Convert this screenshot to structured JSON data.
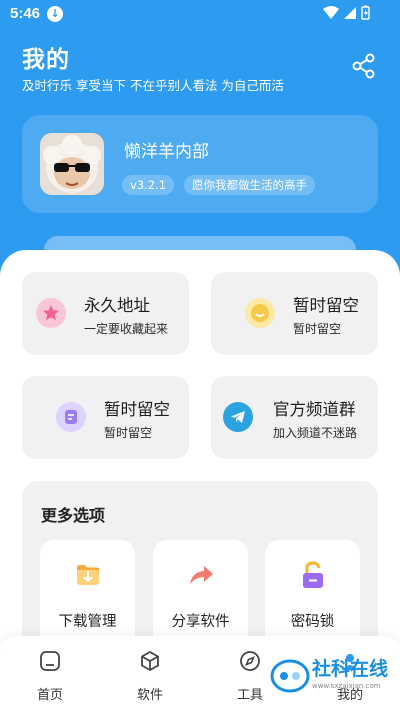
{
  "status_bar": {
    "time": "5:46"
  },
  "header": {
    "title": "我的",
    "subtitle": "及时行乐 享受当下 不在乎别人看法 为自己而活"
  },
  "profile": {
    "name": "懒洋羊内部",
    "version": "v3.2.1",
    "motto": "愿你我都做生活的高手"
  },
  "tiles": [
    {
      "title": "永久地址",
      "subtitle": "一定要收藏起来",
      "icon": "star-icon",
      "color": "#f06292"
    },
    {
      "title": "暂时留空",
      "subtitle": "暂时留空",
      "icon": "smile-icon",
      "color": "#f7c948"
    },
    {
      "title": "暂时留空",
      "subtitle": "暂时留空",
      "icon": "note-icon",
      "color": "#9c7cf0"
    },
    {
      "title": "官方频道群",
      "subtitle": "加入频道不迷路",
      "icon": "telegram-icon",
      "color": "#2aa3e0"
    }
  ],
  "more": {
    "title": "更多选项",
    "options": [
      {
        "label": "下载管理",
        "icon": "download-folder-icon"
      },
      {
        "label": "分享软件",
        "icon": "share-arrow-icon"
      },
      {
        "label": "密码锁",
        "icon": "unlock-icon"
      }
    ]
  },
  "nav": [
    {
      "label": "首页",
      "icon": "home-icon"
    },
    {
      "label": "软件",
      "icon": "cube-icon"
    },
    {
      "label": "工具",
      "icon": "compass-icon"
    },
    {
      "label": "我的",
      "icon": "profile-icon"
    }
  ],
  "watermark": {
    "text": "社科在线",
    "url": "www.sxzaixian.com"
  },
  "colors": {
    "brand_blue": "#2d9bf0",
    "tile_bg": "#f1f1f3"
  }
}
